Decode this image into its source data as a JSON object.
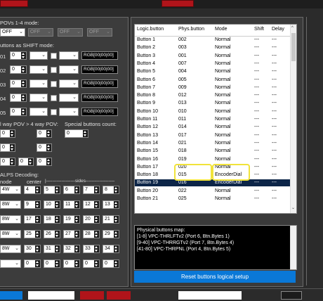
{
  "left": {
    "povs_label": "POVs 1-4 mode:",
    "pov_combos": [
      "OFF",
      "OFF",
      "OFF",
      "OFF"
    ],
    "shift_label": "uttons as SHIFT mode:",
    "shift_rows": [
      {
        "id": "01",
        "val": "0",
        "rgb": "RGB[00|00|00]"
      },
      {
        "id": "02",
        "val": "0",
        "rgb": "RGB[00|00|00]"
      },
      {
        "id": "03",
        "val": "0",
        "rgb": "RGB[00|00|00]"
      },
      {
        "id": "04",
        "val": "0",
        "rgb": "RGB[00|00|00]"
      },
      {
        "id": "05",
        "val": "0",
        "rgb": "RGB[00|00|00]"
      }
    ],
    "pov_way_label": "l way POV > 4 way POV:",
    "special_label": "Special buttons count:",
    "special_val": "0",
    "pov_way_rows": [
      [
        "0",
        "0"
      ],
      [
        "0",
        "0"
      ],
      [
        "0",
        "0",
        "0"
      ]
    ],
    "alps_label": "ALPS Decoding:",
    "mode_label": "node",
    "center_label": "center",
    "sides_label": "|-------------------sides-------------------",
    "alps_rows": [
      {
        "mode": "4W",
        "center": "4",
        "sides": [
          "5",
          "6",
          "7",
          "8"
        ]
      },
      {
        "mode": "8W",
        "center": "9",
        "sides": [
          "10",
          "11",
          "12",
          "13"
        ]
      },
      {
        "mode": "8W",
        "center": "17",
        "sides": [
          "18",
          "19",
          "20",
          "21"
        ]
      },
      {
        "mode": "8W",
        "center": "25",
        "sides": [
          "26",
          "27",
          "28",
          "29"
        ]
      },
      {
        "mode": "8W",
        "center": "30",
        "sides": [
          "31",
          "32",
          "33",
          "34"
        ]
      },
      {
        "mode": "",
        "center": "0",
        "sides": [
          "0",
          "0",
          "0",
          "0"
        ]
      }
    ]
  },
  "table": {
    "headers": [
      "Logic.button",
      "Phys.button",
      "Mode",
      "Shift",
      "Delay"
    ],
    "rows": [
      [
        "Button 1",
        "002",
        "Normal",
        "---",
        "---"
      ],
      [
        "Button 2",
        "003",
        "Normal",
        "---",
        "---"
      ],
      [
        "Button 3",
        "001",
        "Normal",
        "---",
        "---"
      ],
      [
        "Button 4",
        "007",
        "Normal",
        "---",
        "---"
      ],
      [
        "Button 5",
        "004",
        "Normal",
        "---",
        "---"
      ],
      [
        "Button 6",
        "005",
        "Normal",
        "---",
        "---"
      ],
      [
        "Button 7",
        "009",
        "Normal",
        "---",
        "---"
      ],
      [
        "Button 8",
        "012",
        "Normal",
        "---",
        "---"
      ],
      [
        "Button 9",
        "013",
        "Normal",
        "---",
        "---"
      ],
      [
        "Button 10",
        "010",
        "Normal",
        "---",
        "---"
      ],
      [
        "Button 11",
        "011",
        "Normal",
        "---",
        "---"
      ],
      [
        "Button 12",
        "014",
        "Normal",
        "---",
        "---"
      ],
      [
        "Button 13",
        "017",
        "Normal",
        "---",
        "---"
      ],
      [
        "Button 14",
        "021",
        "Normal",
        "---",
        "---"
      ],
      [
        "Button 15",
        "018",
        "Normal",
        "---",
        "---"
      ],
      [
        "Button 16",
        "019",
        "Normal",
        "---",
        "---"
      ],
      [
        "Button 17",
        "020",
        "Normal",
        "---",
        "---"
      ],
      [
        "Button 18",
        "015",
        "EncoderDial",
        "---",
        "---"
      ],
      [
        "Button 19",
        "016",
        "EncoderDial",
        "---",
        "---"
      ],
      [
        "Button 20",
        "022",
        "Normal",
        "---",
        "---"
      ],
      [
        "Button 21",
        "025",
        "Normal",
        "---",
        "---"
      ]
    ]
  },
  "map": {
    "title": "Physical buttons map:",
    "lines": [
      "[1-8] VPC-THRLFTv2 (Port 6, Btn.Bytes 1)",
      "[9-40] VPC-THRRGTv2 (Port 7, Btn.Bytes 4)",
      "[41-80] VPC-THRPNL (Port 4, Btn.Bytes 5)"
    ]
  },
  "reset_label": "Reset buttons logical setup",
  "colors": {
    "accent": "#0a78d7",
    "selected": "#0c2548",
    "highlight": "#f1e33a",
    "danger": "#b0141a"
  }
}
